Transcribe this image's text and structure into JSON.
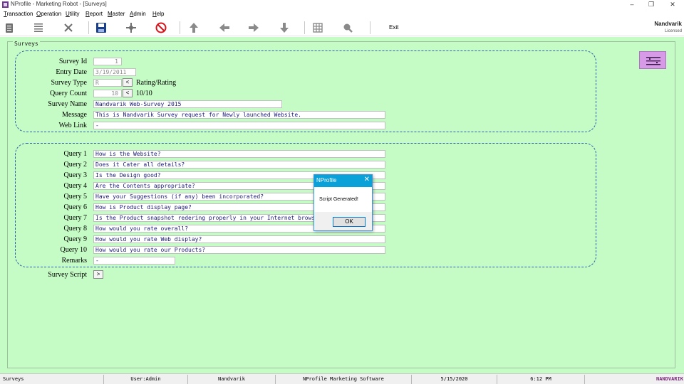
{
  "window": {
    "title": "NProfile - Marketing Robot - [Surveys]",
    "minimize": "–",
    "maximize": "❐",
    "close": "✕"
  },
  "menu": [
    "Transaction",
    "Operation",
    "Utility",
    "Report",
    "Master",
    "Admin",
    "Help"
  ],
  "toolbar": {
    "exit_label": "Exit",
    "company": "Nandvarik",
    "license": "Licensed",
    "icons": [
      "notepad-icon",
      "list-icon",
      "delete-icon",
      "save-icon",
      "move-icon",
      "cancel-icon",
      "up-arrow-icon",
      "left-arrow-icon",
      "right-arrow-icon",
      "down-arrow-icon",
      "grid-icon",
      "search-icon"
    ]
  },
  "form": {
    "panel_title": "Surveys",
    "labels": {
      "survey_id": "Survey Id",
      "entry_date": "Entry Date",
      "survey_type": "Survey Type",
      "query_count": "Query Count",
      "survey_name": "Survey Name",
      "message": "Message",
      "web_link": "Web Link",
      "remarks": "Remarks",
      "survey_script": "Survey Script"
    },
    "values": {
      "survey_id": "1",
      "entry_date": "3/19/2011",
      "survey_type": "R",
      "survey_type_desc": "Rating/Rating",
      "query_count": "10",
      "query_count_desc": "10/10",
      "survey_name": "Nandvarik Web-Survey 2015",
      "message": "This is Nandvarik Survey request for Newly launched Website.",
      "web_link": "-",
      "remarks": "-"
    },
    "lookup_btn": "<",
    "script_btn": ">",
    "queries": [
      {
        "label": "Query 1",
        "value": "How is the Website?"
      },
      {
        "label": "Query 2",
        "value": "Does it Cater all details?"
      },
      {
        "label": "Query 3",
        "value": "Is the Design good?"
      },
      {
        "label": "Query 4",
        "value": "Are the Contents appropriate?"
      },
      {
        "label": "Query 5",
        "value": "Have your Suggestions (if any) been incorporated?"
      },
      {
        "label": "Query 6",
        "value": "How is Product display page?"
      },
      {
        "label": "Query 7",
        "value": "Is the Product snapshot redering properly in your Internet browser?"
      },
      {
        "label": "Query 8",
        "value": "How would you rate overall?"
      },
      {
        "label": "Query 9",
        "value": "How would you rate Web display?"
      },
      {
        "label": "Query 10",
        "value": "How would you rate our Products?"
      }
    ]
  },
  "dialog": {
    "title": "NProfile",
    "close": "✕",
    "message": "Script Generated!",
    "ok": "OK"
  },
  "statusbar": {
    "form": "Surveys",
    "user": "User:Admin",
    "company": "Nandvarik",
    "product": "NProfile Marketing Software",
    "date": "5/15/2020",
    "time": "6:12 PM",
    "logo": "NANDVARIK"
  },
  "colors": {
    "form_bg": "#c5fbc5",
    "group_border": "#2d5da8",
    "dialog_title": "#0aa0d8",
    "side_button": "#d69ae6"
  }
}
